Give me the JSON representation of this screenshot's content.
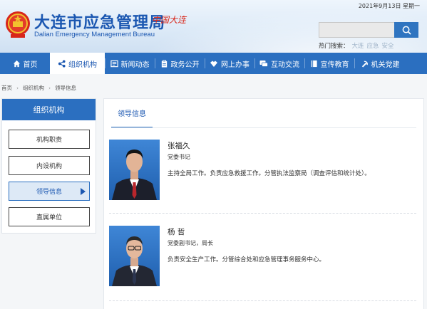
{
  "header": {
    "date": "2021年9月13日 星期一",
    "site_title": "大连市应急管理局",
    "site_title_en": "Dalian Emergency Management Bureau",
    "slogan": "中国大连",
    "search": {
      "placeholder": "",
      "hot_label": "热门搜索：",
      "hot_items": [
        "大连",
        "应急",
        "安全"
      ]
    }
  },
  "nav": {
    "items": [
      {
        "label": "首页",
        "icon": "home-icon"
      },
      {
        "label": "组织机构",
        "icon": "share-icon",
        "active": true
      },
      {
        "label": "新闻动态",
        "icon": "news-icon"
      },
      {
        "label": "政务公开",
        "icon": "clipboard-icon"
      },
      {
        "label": "网上办事",
        "icon": "handshake-icon"
      },
      {
        "label": "互动交流",
        "icon": "chat-icon"
      },
      {
        "label": "宣传教育",
        "icon": "book-icon"
      },
      {
        "label": "机关党建",
        "icon": "party-emblem-icon"
      }
    ]
  },
  "breadcrumb": [
    "首页",
    "组织机构",
    "领导信息"
  ],
  "sidebar": {
    "title": "组织机构",
    "items": [
      {
        "label": "机构职责"
      },
      {
        "label": "内设机构"
      },
      {
        "label": "领导信息",
        "active": true
      },
      {
        "label": "直属单位"
      }
    ]
  },
  "main": {
    "tab": "领导信息",
    "leaders": [
      {
        "name": "张福久",
        "title": "党委书记",
        "duty": "主持全局工作。负责应急救援工作。分管执法监察局（调查评估和统计处）。"
      },
      {
        "name": "杨  哲",
        "title": "党委副书记，局长",
        "duty": "负责安全生产工作。分管综合处和应急管理事务服务中心。"
      }
    ]
  },
  "colors": {
    "brand_blue": "#2b6fc0",
    "title_blue": "#1b57b1",
    "slogan_red": "#d8261a"
  }
}
